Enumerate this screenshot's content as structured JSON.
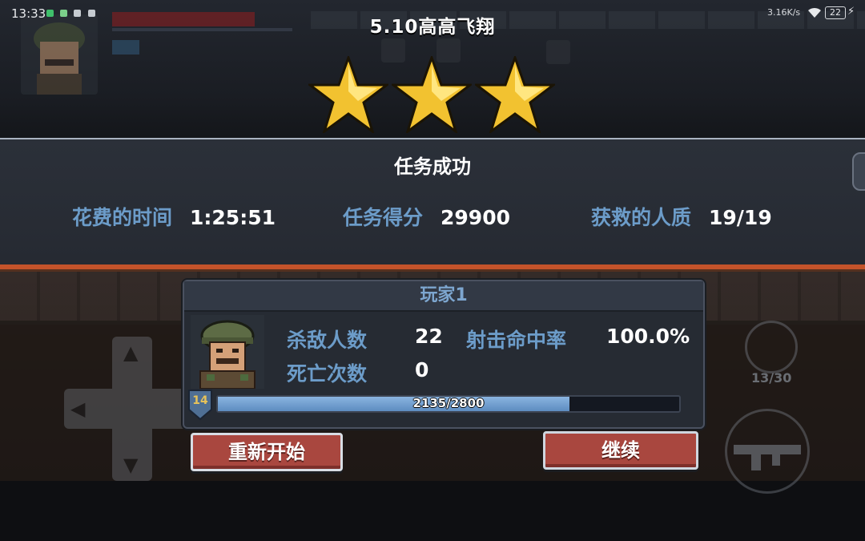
{
  "status_bar": {
    "time": "13:33",
    "net_speed": "3.16K/s",
    "battery": "22"
  },
  "level": {
    "title": "5.10高高飞翔",
    "stars_earned": 3,
    "stars_total": 3
  },
  "summary": {
    "title": "任务成功",
    "stats": [
      {
        "label": "花费的时间",
        "value": "1:25:51"
      },
      {
        "label": "任务得分",
        "value": "29900"
      },
      {
        "label": "获救的人质",
        "value": "19/19"
      }
    ]
  },
  "player": {
    "name": "玩家1",
    "kills_label": "杀敌人数",
    "kills": "22",
    "accuracy_label": "射击命中率",
    "accuracy": "100.0%",
    "deaths_label": "死亡次数",
    "deaths": "0",
    "level": "14",
    "xp_text": "2135/2800",
    "xp_fraction": 0.7625
  },
  "buttons": {
    "restart": "重新开始",
    "continue": "继续"
  },
  "hud": {
    "ammo": "13/30"
  },
  "colors": {
    "label_blue": "#6c9cc9",
    "button_red": "#a9473f",
    "band_accent": "#c4532a",
    "star_gold": "#f2c230"
  }
}
